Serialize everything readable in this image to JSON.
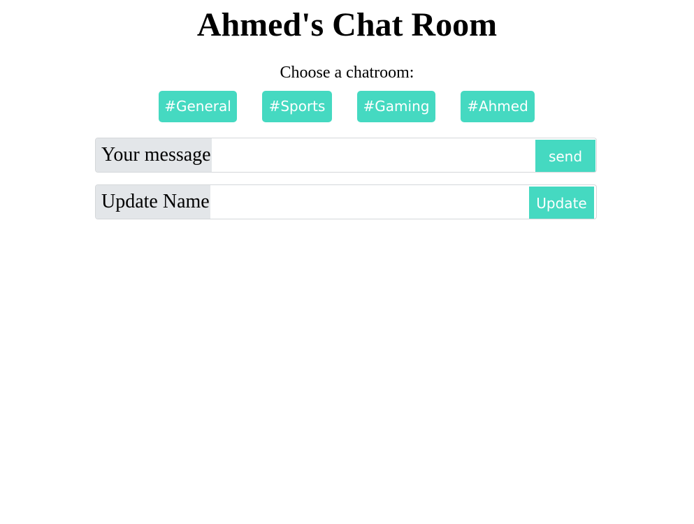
{
  "header": {
    "title": "Ahmed's Chat Room",
    "choose_label": "Choose a chatroom:"
  },
  "rooms": [
    {
      "label": "#General"
    },
    {
      "label": "#Sports"
    },
    {
      "label": "#Gaming"
    },
    {
      "label": "#Ahmed"
    }
  ],
  "message_form": {
    "label": "Your message",
    "value": "",
    "button_label": "send"
  },
  "name_form": {
    "label": "Update Name",
    "value": "",
    "button_label": "Update"
  },
  "colors": {
    "accent": "#45d9c1",
    "addon_bg": "#e3e6e9",
    "border": "#d4d7da"
  }
}
